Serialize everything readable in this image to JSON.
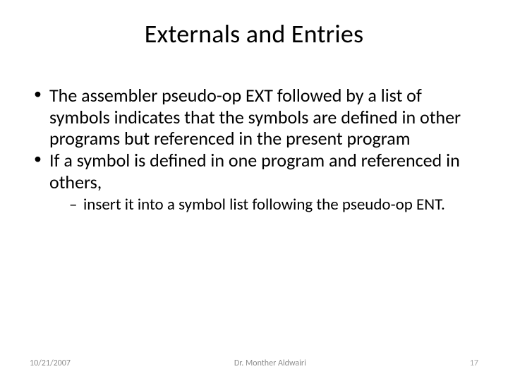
{
  "title": "Externals and Entries",
  "bullets": {
    "item1": "The assembler pseudo-op EXT followed by a list of symbols indicates that the symbols are defined in other programs but referenced in the present program",
    "item2": "If a symbol is defined in one program and referenced in others,",
    "subitem1": "insert it into a symbol list following the pseudo-op ENT."
  },
  "footer": {
    "date": "10/21/2007",
    "author": "Dr. Monther Aldwairi",
    "page": "17"
  }
}
